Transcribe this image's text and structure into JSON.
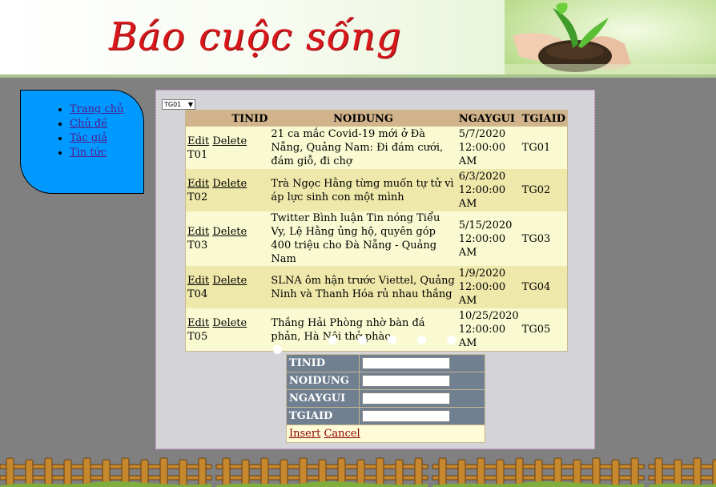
{
  "banner": {
    "title": "Báo cuộc sống"
  },
  "sidebar": {
    "items": [
      {
        "label": "Trang chủ"
      },
      {
        "label": "Chủ đề"
      },
      {
        "label": "Tác giả"
      },
      {
        "label": "Tin tức"
      }
    ]
  },
  "filter": {
    "selected": "TG01"
  },
  "grid": {
    "headers": [
      "TINID",
      "NOIDUNG",
      "NGAYGUI",
      "TGIAID"
    ],
    "edit_label": "Edit",
    "delete_label": "Delete",
    "rows": [
      {
        "tinid": "T01",
        "noidung": "21 ca mắc Covid-19 mới ở Đà Nẵng, Quảng Nam: Đi đám cưới, đám giỗ, đi chợ",
        "ngaygui": "5/7/2020 12:00:00 AM",
        "tgiaid": "TG01"
      },
      {
        "tinid": "T02",
        "noidung": "Trà Ngọc Hằng từng muốn tự tử vì áp lực sinh con một mình",
        "ngaygui": "6/3/2020 12:00:00 AM",
        "tgiaid": "TG02"
      },
      {
        "tinid": "T03",
        "noidung": "Twitter Bình luận Tin nóng Tiểu Vy, Lệ Hằng ủng hộ, quyên góp 400 triệu cho Đà Nẵng - Quảng Nam",
        "ngaygui": "5/15/2020 12:00:00 AM",
        "tgiaid": "TG03"
      },
      {
        "tinid": "T04",
        "noidung": "SLNA ôm hận trước Viettel, Quảng Ninh và Thanh Hóa rủ nhau thắng",
        "ngaygui": "1/9/2020 12:00:00 AM",
        "tgiaid": "TG04"
      },
      {
        "tinid": "T05",
        "noidung": "Thắng Hải Phòng nhờ bàn đá phản, Hà Nội thở phào",
        "ngaygui": "10/25/2020 12:00:00 AM",
        "tgiaid": "TG05"
      }
    ]
  },
  "form": {
    "fields": [
      {
        "label": "TINID",
        "value": ""
      },
      {
        "label": "NOIDUNG",
        "value": ""
      },
      {
        "label": "NGAYGUI",
        "value": ""
      },
      {
        "label": "TGIAID",
        "value": ""
      }
    ],
    "insert_label": "Insert",
    "cancel_label": "Cancel"
  }
}
